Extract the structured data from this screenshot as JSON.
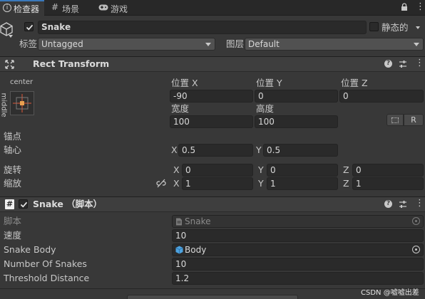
{
  "tabs": [
    {
      "label": "检查器",
      "icon": "info-icon"
    },
    {
      "label": "场景",
      "icon": "grid-icon"
    },
    {
      "label": "游戏",
      "icon": "gamepad-icon"
    }
  ],
  "gameobject": {
    "name": "Snake",
    "active": true,
    "static_label": "静态的",
    "static": false,
    "tag_label": "标签",
    "tag_value": "Untagged",
    "layer_label": "图层",
    "layer_value": "Default"
  },
  "rect_transform": {
    "title": "Rect Transform",
    "anchor_preset_top": "center",
    "anchor_preset_side": "middle",
    "pos_x_label": "位置 X",
    "pos_x": "-90",
    "pos_y_label": "位置 Y",
    "pos_y": "0",
    "pos_z_label": "位置 Z",
    "pos_z": "0",
    "width_label": "宽度",
    "width": "100",
    "height_label": "高度",
    "height": "100",
    "blueprint_btn": "",
    "raw_btn": "R",
    "anchors_label": "锚点",
    "pivot_label": "轴心",
    "pivot_x_label": "X",
    "pivot_x": "0.5",
    "pivot_y_label": "Y",
    "pivot_y": "0.5",
    "rotation_label": "旋转",
    "rot_x_label": "X",
    "rot_x": "0",
    "rot_y_label": "Y",
    "rot_y": "0",
    "rot_z_label": "Z",
    "rot_z": "0",
    "scale_label": "缩放",
    "scale_x_label": "X",
    "scale_x": "1",
    "scale_y_label": "Y",
    "scale_y": "1",
    "scale_z_label": "Z",
    "scale_z": "1"
  },
  "script_component": {
    "title": "Snake （脚本）",
    "enabled": true,
    "script_label": "脚本",
    "script_value": "Snake",
    "speed_label": "速度",
    "speed_value": "10",
    "snake_body_label": "Snake Body",
    "snake_body_value": "Body",
    "num_snakes_label": "Number Of Snakes",
    "num_snakes_value": "10",
    "threshold_label": "Threshold Distance",
    "threshold_value": "1.2"
  },
  "watermark": "CSDN @嘘嘘出差",
  "colors": {
    "background": "#383838",
    "field": "#2a2a2a",
    "header": "#3e3e3e",
    "anchor_red": "#e05a3a",
    "anchor_orange": "#e8a050",
    "prefab_blue": "#4da3e0"
  }
}
